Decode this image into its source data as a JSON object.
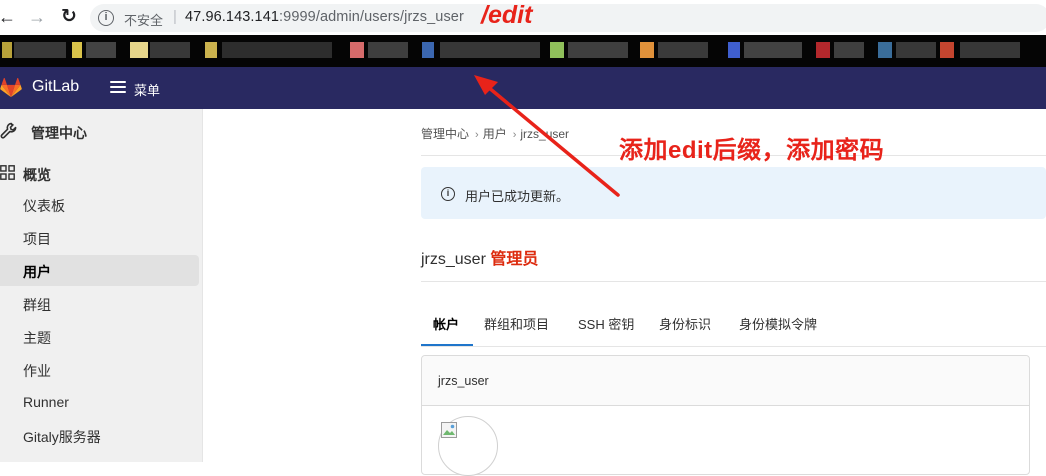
{
  "browser": {
    "security_label": "不安全",
    "url_host": "47.96.143.141",
    "url_port": ":9999",
    "url_path": "/admin/users/jrzs_user"
  },
  "annotations": {
    "url_suffix": "/edit",
    "instruction": "添加edit后缀，添加密码",
    "color": "#e8231a"
  },
  "header": {
    "brand": "GitLab",
    "menu_label": "菜单",
    "background": "#292961"
  },
  "sidebar": {
    "title": "管理中心",
    "section": "概览",
    "items": [
      {
        "label": "仪表板",
        "active": false
      },
      {
        "label": "项目",
        "active": false
      },
      {
        "label": "用户",
        "active": true
      },
      {
        "label": "群组",
        "active": false
      },
      {
        "label": "主题",
        "active": false
      },
      {
        "label": "作业",
        "active": false
      },
      {
        "label": "Runner",
        "active": false
      },
      {
        "label": "Gitaly服务器",
        "active": false
      }
    ]
  },
  "breadcrumb": [
    "管理中心",
    "用户",
    "jrzs_user"
  ],
  "alert": {
    "text": "用户已成功更新。"
  },
  "user": {
    "username": "jrzs_user",
    "badge": "管理员"
  },
  "tabs": [
    {
      "label": "帐户",
      "active": true
    },
    {
      "label": "群组和项目",
      "active": false
    },
    {
      "label": "SSH 密钥",
      "active": false
    },
    {
      "label": "身份标识",
      "active": false
    },
    {
      "label": "身份模拟令牌",
      "active": false
    }
  ],
  "card": {
    "title": "jrzs_user"
  }
}
